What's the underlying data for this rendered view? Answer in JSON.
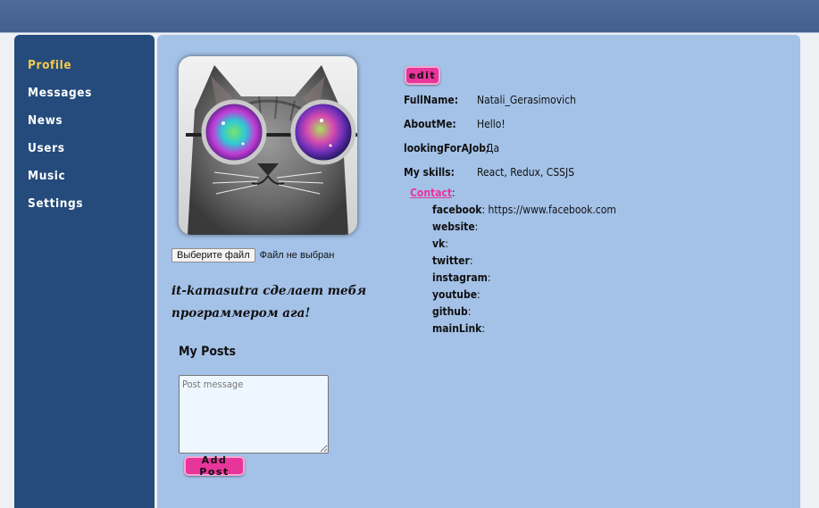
{
  "sidebar": {
    "items": [
      {
        "label": "Profile"
      },
      {
        "label": "Messages"
      },
      {
        "label": "News"
      },
      {
        "label": "Users"
      },
      {
        "label": "Music"
      },
      {
        "label": "Settings"
      }
    ],
    "active_color": "#f7c948"
  },
  "profile": {
    "avatar_icon": "cat-with-galaxy-glasses-photo",
    "file_button_label": "Выберите файл",
    "file_status": "Файл не выбран",
    "status_text": "it-kamasutra сделает тебя программером ага!",
    "edit_label": "edit",
    "fields": [
      {
        "label": "FullName:",
        "value": "Natali_Gerasimovich"
      },
      {
        "label": "AboutMe:",
        "value": "Hello!"
      },
      {
        "label": "lookingForAJob:",
        "value": "Да"
      },
      {
        "label": "My skills:",
        "value": "React, Redux, CSSJS"
      }
    ],
    "contacts_label": "Contact",
    "contacts": [
      {
        "key": "facebook",
        "value": "https://www.facebook.com"
      },
      {
        "key": "website",
        "value": ""
      },
      {
        "key": "vk",
        "value": ""
      },
      {
        "key": "twitter",
        "value": ""
      },
      {
        "key": "instagram",
        "value": ""
      },
      {
        "key": "youtube",
        "value": ""
      },
      {
        "key": "github",
        "value": ""
      },
      {
        "key": "mainLink",
        "value": ""
      }
    ]
  },
  "posts": {
    "title": "My Posts",
    "placeholder": "Post message",
    "add_button_label": "Add Post"
  },
  "colors": {
    "topbar": "#4a6592",
    "sidebar": "#244b7b",
    "content": "#a4c2e8",
    "accent_pink": "#e8359a"
  }
}
